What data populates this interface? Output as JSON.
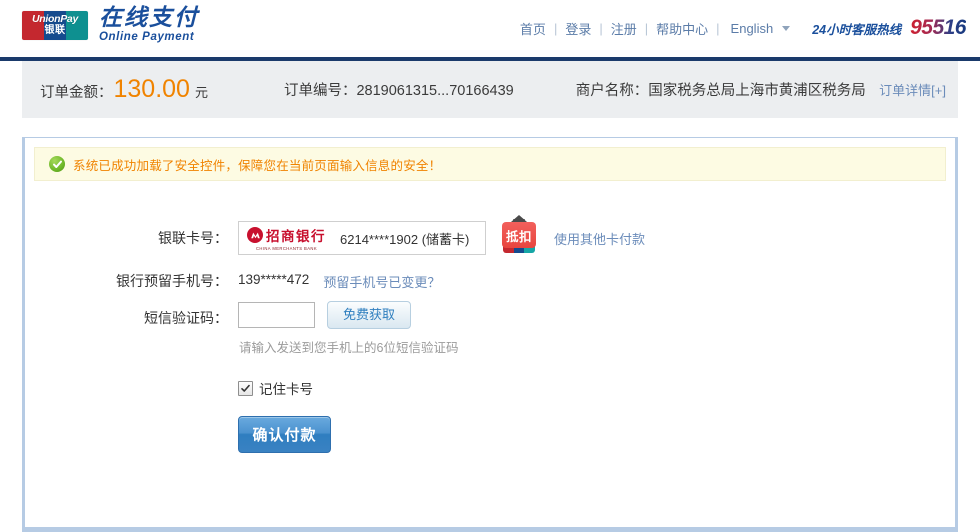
{
  "header": {
    "logo": {
      "mark_line1": "UnionPay",
      "mark_line2": "银联",
      "brand_cn": "在线支付",
      "brand_en": "Online Payment"
    },
    "nav": [
      {
        "label": "首页"
      },
      {
        "label": "登录"
      },
      {
        "label": "注册"
      },
      {
        "label": "帮助中心"
      }
    ],
    "separator": "|",
    "language": "English",
    "hotline_label": "24小时客服热线",
    "hotline_number": "95516",
    "hotline_color_start": "#cf202f",
    "hotline_color_end": "#16397f"
  },
  "order_bar": {
    "amount_label": "订单金额：",
    "amount_value": "130.00",
    "amount_unit": "元",
    "amount_color": "#f08300",
    "order_no_label": "订单编号：",
    "order_no_value": "2819061315...70166439",
    "merchant_label": "商户名称：",
    "merchant_value": "国家税务总局上海市黄浦区税务局",
    "detail_link": "订单详情[+]"
  },
  "notice": {
    "icon": "check-circle-icon",
    "text": "系统已成功加载了安全控件，保障您在当前页面输入信息的安全！",
    "text_color": "#f08300",
    "background": "#fdfbe3"
  },
  "form": {
    "card": {
      "label": "银联卡号：",
      "bank_name": "招商银行",
      "bank_name_en": "CHINA MERCHANTS BANK",
      "bank_color": "#c8102e",
      "card_number": "6214****1902 (储蓄卡)",
      "badge_text": "抵扣",
      "badge_color": "#e8453f",
      "other_card_link": "使用其他卡付款"
    },
    "phone": {
      "label": "银行预留手机号：",
      "value": "139*****472",
      "changed_link": "预留手机号已变更？"
    },
    "sms": {
      "label": "短信验证码：",
      "input_value": "",
      "input_placeholder": "",
      "get_code_button": "免费获取",
      "hint": "请输入发送到您手机上的6位短信验证码"
    },
    "remember": {
      "label": "记住卡号",
      "checked": true
    },
    "submit_button": "确认付款"
  }
}
